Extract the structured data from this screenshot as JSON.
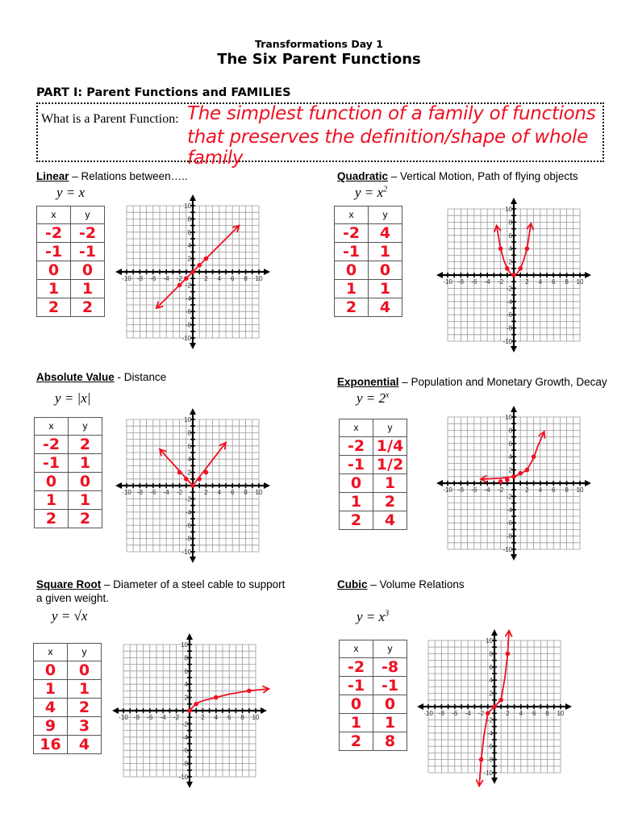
{
  "header": {
    "subtitle": "Transformations Day 1",
    "title": "The Six Parent Functions"
  },
  "part": {
    "heading": "PART I: Parent Functions and FAMILIES",
    "question_label": "What is a Parent Function:",
    "answer_line1": "The simplest function of a family of functions",
    "answer_line2": "that preserves the definition/shape of whole family"
  },
  "colors": {
    "ink": "#ee1122",
    "grid": "#9a9a9a",
    "axis": "#000000"
  },
  "sections": [
    {
      "name": "Linear",
      "description": " – Relations between…..",
      "equation": "y = x",
      "table_headers": [
        "x",
        "y"
      ],
      "rows": [
        [
          "-2",
          "-2"
        ],
        [
          "-1",
          "-1"
        ],
        [
          "0",
          "0"
        ],
        [
          "1",
          "1"
        ],
        [
          "2",
          "2"
        ]
      ]
    },
    {
      "name": "Quadratic",
      "description": " – Vertical Motion, Path of flying objects",
      "equation": "y = x",
      "equation_sup": "2",
      "table_headers": [
        "x",
        "y"
      ],
      "rows": [
        [
          "-2",
          "4"
        ],
        [
          "-1",
          "1"
        ],
        [
          "0",
          "0"
        ],
        [
          "1",
          "1"
        ],
        [
          "2",
          "4"
        ]
      ]
    },
    {
      "name": "Absolute Value",
      "description": " - Distance",
      "equation": "y = |x|",
      "table_headers": [
        "x",
        "y"
      ],
      "rows": [
        [
          "-2",
          "2"
        ],
        [
          "-1",
          "1"
        ],
        [
          "0",
          "0"
        ],
        [
          "1",
          "1"
        ],
        [
          "2",
          "2"
        ]
      ]
    },
    {
      "name": "Exponential",
      "description": " – Population and Monetary Growth, Decay",
      "equation": "y = 2",
      "equation_sup": "x",
      "table_headers": [
        "x",
        "y"
      ],
      "rows": [
        [
          "-2",
          "1/4"
        ],
        [
          "-1",
          "1/2"
        ],
        [
          "0",
          "1"
        ],
        [
          "1",
          "2"
        ],
        [
          "2",
          "4"
        ]
      ]
    },
    {
      "name": "Square Root",
      "description": " – Diameter of a steel cable to support",
      "description2": "a given weight.",
      "equation": "y = √x",
      "table_headers": [
        "x",
        "y"
      ],
      "rows": [
        [
          "0",
          "0"
        ],
        [
          "1",
          "1"
        ],
        [
          "4",
          "2"
        ],
        [
          "9",
          "3"
        ],
        [
          "16",
          "4"
        ]
      ]
    },
    {
      "name": "Cubic",
      "description": " – Volume Relations",
      "equation": "y = x",
      "equation_sup": "3",
      "table_headers": [
        "x",
        "y"
      ],
      "rows": [
        [
          "-2",
          "-8"
        ],
        [
          "-1",
          "-1"
        ],
        [
          "0",
          "0"
        ],
        [
          "1",
          "1"
        ],
        [
          "2",
          "8"
        ]
      ]
    }
  ],
  "chart_data": [
    {
      "type": "line",
      "title": "Linear",
      "function": "y = x",
      "x_ticks": [
        -10,
        -8,
        -6,
        -4,
        -2,
        2,
        4,
        6,
        8,
        10
      ],
      "y_ticks": [
        10,
        8,
        6,
        4,
        2,
        -2,
        -4,
        -6,
        -8,
        -10
      ],
      "xlim": [
        -10,
        10
      ],
      "ylim": [
        -10,
        10
      ],
      "grid": true,
      "points": [
        [
          -2,
          -2
        ],
        [
          -1,
          -1
        ],
        [
          0,
          0
        ],
        [
          1,
          1
        ],
        [
          2,
          2
        ]
      ],
      "curve": [
        [
          -5.5,
          -5.5
        ],
        [
          7,
          7
        ]
      ],
      "arrows": "both"
    },
    {
      "type": "line",
      "title": "Quadratic",
      "function": "y = x^2",
      "x_ticks": [
        -10,
        -8,
        -6,
        -4,
        -2,
        2,
        4,
        6,
        8,
        10
      ],
      "y_ticks": [
        10,
        8,
        6,
        4,
        2,
        -2,
        -4,
        -6,
        -8,
        -10
      ],
      "xlim": [
        -10,
        10
      ],
      "ylim": [
        -10,
        10
      ],
      "grid": true,
      "points": [
        [
          -2,
          4
        ],
        [
          -1,
          1
        ],
        [
          0,
          0
        ],
        [
          1,
          1
        ],
        [
          2,
          4
        ]
      ],
      "curve": [
        [
          -2.6,
          7.5
        ],
        [
          -2,
          4
        ],
        [
          -1.5,
          2.25
        ],
        [
          -1,
          1
        ],
        [
          -0.5,
          0.25
        ],
        [
          0,
          0
        ],
        [
          0.5,
          0.25
        ],
        [
          1,
          1
        ],
        [
          1.5,
          2.25
        ],
        [
          2,
          4
        ],
        [
          2.6,
          7.8
        ]
      ],
      "arrows": "both"
    },
    {
      "type": "line",
      "title": "Absolute Value",
      "function": "y = |x|",
      "x_ticks": [
        -10,
        -8,
        -6,
        -4,
        -2,
        2,
        4,
        6,
        8,
        10
      ],
      "y_ticks": [
        10,
        8,
        6,
        4,
        2,
        -2,
        -4,
        -6,
        -8,
        -10
      ],
      "xlim": [
        -10,
        10
      ],
      "ylim": [
        -10,
        10
      ],
      "grid": true,
      "points": [
        [
          -2,
          2
        ],
        [
          -1,
          1
        ],
        [
          0,
          0
        ],
        [
          1,
          1
        ],
        [
          2,
          2
        ]
      ],
      "curve": [
        [
          -5,
          5.5
        ],
        [
          0,
          0
        ],
        [
          5,
          6.5
        ]
      ],
      "arrows": "both"
    },
    {
      "type": "line",
      "title": "Exponential",
      "function": "y = 2^x",
      "x_ticks": [
        -10,
        -8,
        -6,
        -4,
        -2,
        2,
        4,
        6,
        8,
        10
      ],
      "y_ticks": [
        10,
        8,
        6,
        4,
        2,
        -2,
        -4,
        -6,
        -8,
        -10
      ],
      "xlim": [
        -10,
        10
      ],
      "ylim": [
        -10,
        10
      ],
      "grid": true,
      "points": [
        [
          -2,
          0.25
        ],
        [
          -1,
          0.5
        ],
        [
          0,
          1
        ],
        [
          1,
          1.5
        ],
        [
          2,
          2
        ],
        [
          3,
          4
        ]
      ],
      "curve": [
        [
          -5,
          0.6
        ],
        [
          -2,
          0.75
        ],
        [
          0,
          1
        ],
        [
          1,
          1.4
        ],
        [
          2,
          2
        ],
        [
          3,
          3.8
        ],
        [
          3.6,
          5.5
        ],
        [
          4.6,
          7.8
        ]
      ],
      "arrows": "both"
    },
    {
      "type": "line",
      "title": "Square Root",
      "function": "y = sqrt(x)",
      "x_ticks": [
        -10,
        -8,
        -6,
        -4,
        -2,
        2,
        4,
        6,
        8,
        10
      ],
      "y_ticks": [
        10,
        8,
        6,
        4,
        2,
        -2,
        -4,
        -6,
        -8,
        -10
      ],
      "xlim": [
        -10,
        10
      ],
      "ylim": [
        -10,
        10
      ],
      "grid": true,
      "points": [
        [
          0,
          0
        ],
        [
          1,
          1
        ],
        [
          4,
          2
        ],
        [
          9,
          3
        ]
      ],
      "curve": [
        [
          0,
          0
        ],
        [
          1,
          1.1
        ],
        [
          2,
          1.5
        ],
        [
          4,
          2
        ],
        [
          6,
          2.5
        ],
        [
          9,
          3
        ],
        [
          12,
          3.3
        ]
      ],
      "arrows": "end"
    },
    {
      "type": "line",
      "title": "Cubic",
      "function": "y = x^3",
      "x_ticks": [
        -10,
        -8,
        -6,
        -4,
        -2,
        2,
        4,
        6,
        8,
        10
      ],
      "y_ticks": [
        10,
        8,
        6,
        4,
        2,
        -2,
        -4,
        -6,
        -8,
        -10
      ],
      "xlim": [
        -10,
        10
      ],
      "ylim": [
        -10,
        10
      ],
      "grid": true,
      "points": [
        [
          -2,
          -8
        ],
        [
          -1,
          -1
        ],
        [
          0,
          0
        ],
        [
          1,
          1
        ],
        [
          2,
          8
        ]
      ],
      "curve": [
        [
          -2.3,
          -12
        ],
        [
          -2,
          -8
        ],
        [
          -1.6,
          -4.5
        ],
        [
          -1,
          -1
        ],
        [
          0,
          0
        ],
        [
          1,
          1
        ],
        [
          1.6,
          4.5
        ],
        [
          2,
          8
        ],
        [
          2.2,
          11.5
        ]
      ],
      "arrows": "both"
    }
  ]
}
